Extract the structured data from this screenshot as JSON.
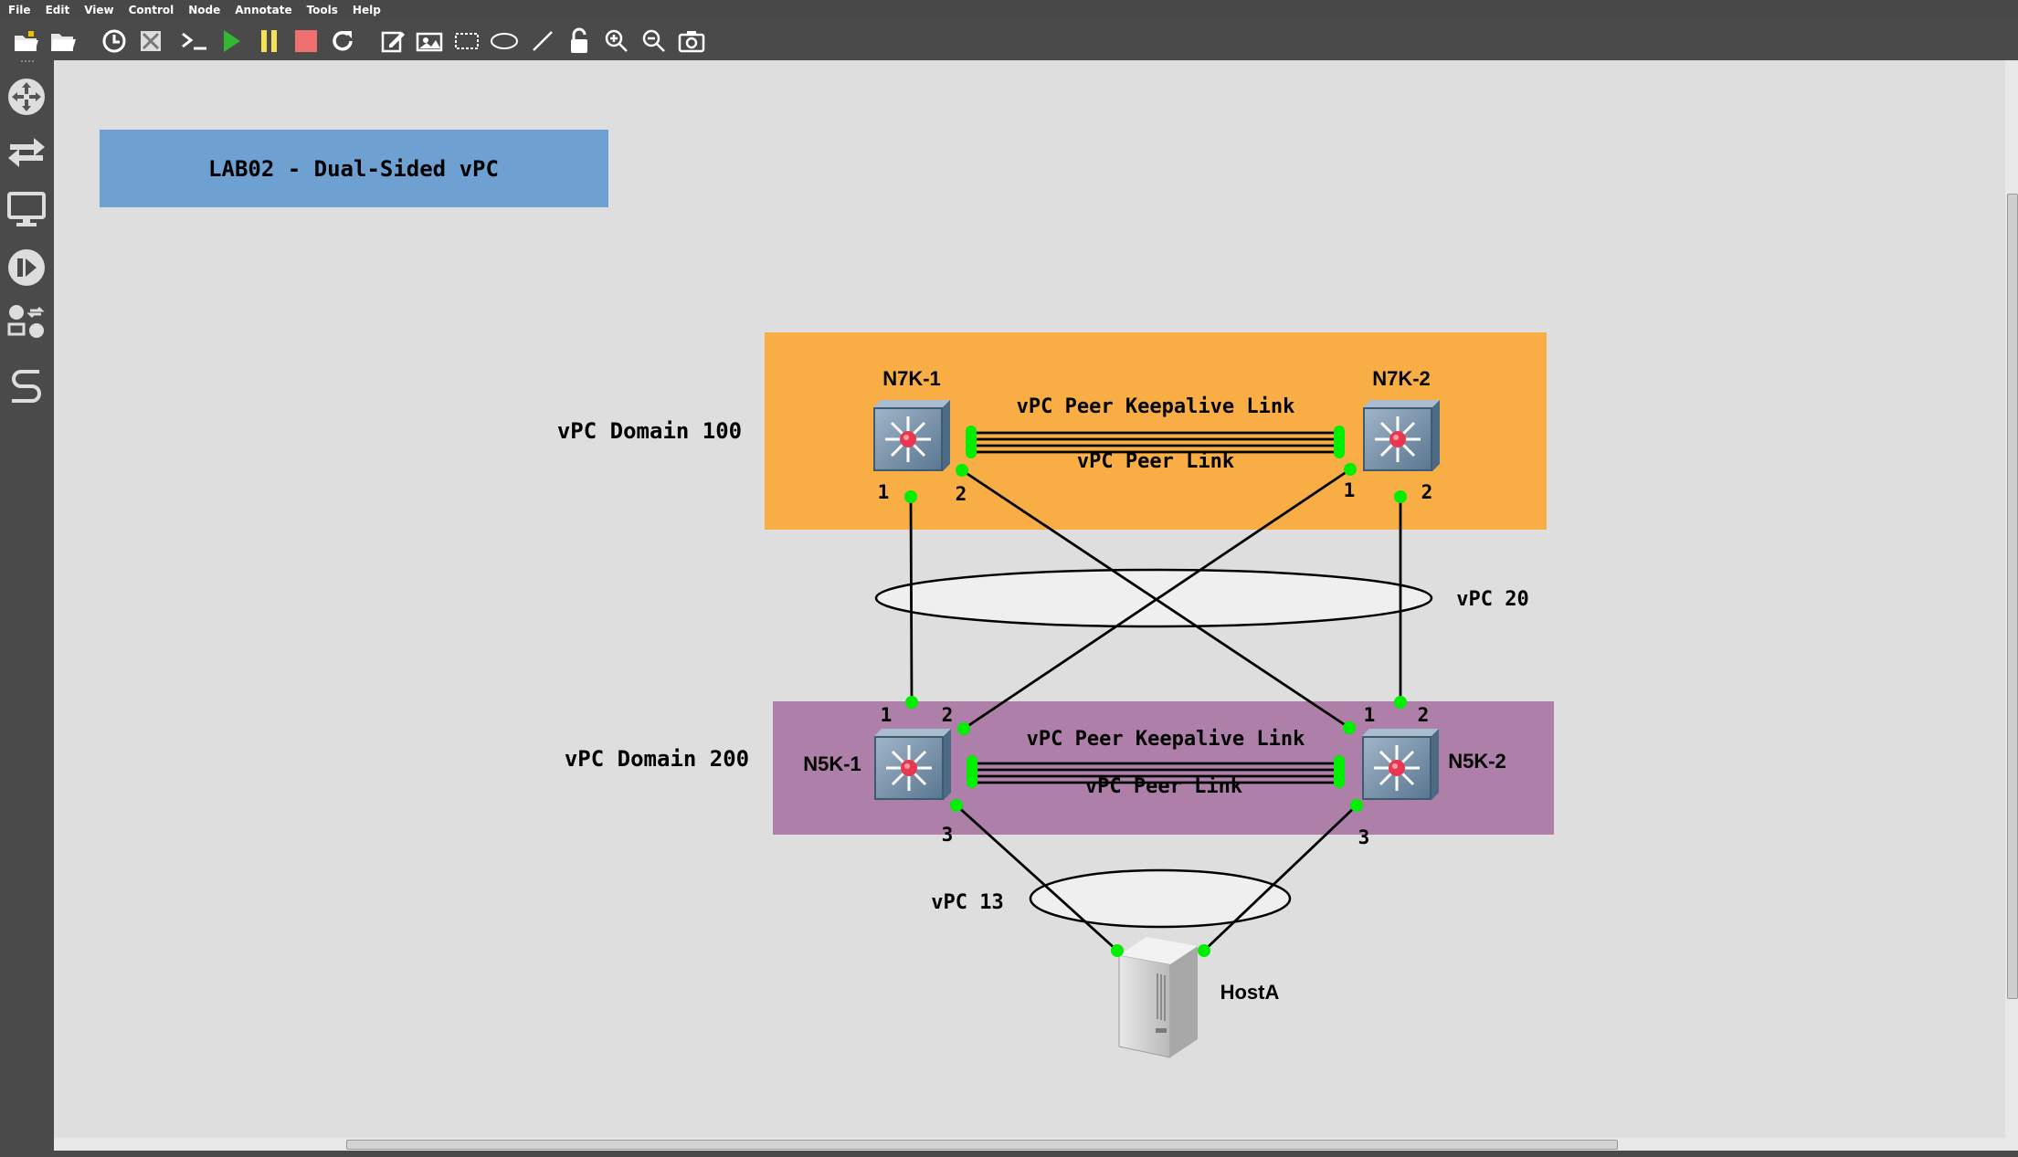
{
  "menu": [
    "File",
    "Edit",
    "View",
    "Control",
    "Node",
    "Annotate",
    "Tools",
    "Help"
  ],
  "toolbar": [
    "open-project-icon",
    "open-folder-icon",
    "snapshot-clock-icon",
    "show-topology-icon",
    "console-icon",
    "start-icon",
    "pause-icon",
    "stop-icon",
    "reload-icon",
    "add-note-icon",
    "insert-picture-icon",
    "draw-rectangle-icon",
    "draw-ellipse-icon",
    "draw-line-icon",
    "lock-icon",
    "zoom-in-icon",
    "zoom-out-icon",
    "screenshot-icon"
  ],
  "sidebar": [
    "routers-icon",
    "switches-icon",
    "end-devices-icon",
    "security-devices-icon",
    "all-devices-icon",
    "add-link-icon"
  ],
  "colors": {
    "domain100": "#f9ad45",
    "domain200": "#ae7fa9",
    "title_bg": "#6fa0d2",
    "port_dot": "#00ee00",
    "canvas": "#dedede"
  },
  "diagram": {
    "title": "LAB02 - Dual-Sided vPC",
    "domain100_label": "vPC Domain 100",
    "domain200_label": "vPC Domain 200",
    "vpc20_label": "vPC 20",
    "vpc13_label": "vPC 13",
    "nodes": {
      "n7k1": "N7K-1",
      "n7k2": "N7K-2",
      "n5k1": "N5K-1",
      "n5k2": "N5K-2",
      "host": "HostA"
    },
    "top_keepalive": "vPC Peer Keepalive Link",
    "top_peer_link": "vPC Peer Link",
    "bottom_keepalive": "vPC Peer Keepalive Link",
    "bottom_peer_link": "vPC Peer Link",
    "ports": {
      "n7k1_p1": "1",
      "n7k1_p2": "2",
      "n7k2_p1": "1",
      "n7k2_p2": "2",
      "n5k1_p1": "1",
      "n5k1_p2": "2",
      "n5k1_p3": "3",
      "n5k2_p1": "1",
      "n5k2_p2": "2",
      "n5k2_p3": "3"
    }
  }
}
